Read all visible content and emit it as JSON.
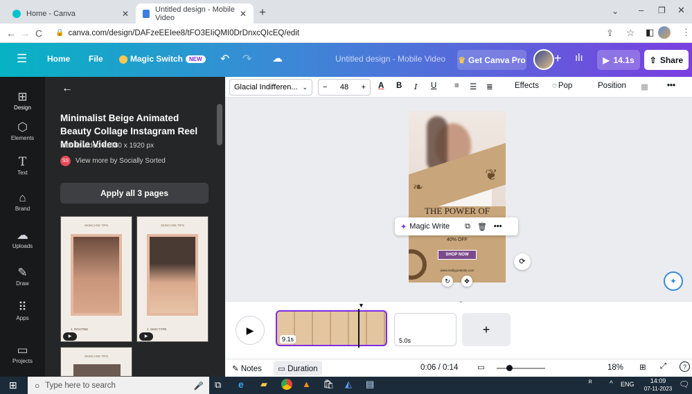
{
  "browser": {
    "tabs": [
      {
        "title": "Home - Canva"
      },
      {
        "title": "Untitled design - Mobile Video"
      }
    ],
    "url": "canva.com/design/DAFzeEEIee8/tFO3EIiQMI0DrDnxcQIcEQ/edit"
  },
  "header": {
    "home": "Home",
    "file": "File",
    "magic_switch": "Magic Switch",
    "new_badge": "NEW",
    "doc_title": "Untitled design - Mobile Video",
    "get_pro": "Get Canva Pro",
    "duration": "14.1s",
    "share": "Share"
  },
  "rail": [
    {
      "label": "Design",
      "icon": "design-icon"
    },
    {
      "label": "Elements",
      "icon": "elements-icon"
    },
    {
      "label": "Text",
      "icon": "text-icon"
    },
    {
      "label": "Brand",
      "icon": "brand-icon"
    },
    {
      "label": "Uploads",
      "icon": "uploads-icon"
    },
    {
      "label": "Draw",
      "icon": "draw-icon"
    },
    {
      "label": "Apps",
      "icon": "apps-icon"
    },
    {
      "label": "Projects",
      "icon": "projects-icon"
    }
  ],
  "panel": {
    "title": "Minimalist Beige Animated Beauty Collage Instagram Reel Mobile Video",
    "meta": "Mobile Video • 1080 x 1920 px",
    "avatar": "SS",
    "view_more": "View more by Socially Sorted",
    "apply": "Apply all 3 pages",
    "thumbs": [
      {
        "tag": "SKINCARE TIPS",
        "caption": "1. ROUTINE"
      },
      {
        "tag": "SKINCARE TIPS",
        "caption": "2. SKIN TYPE"
      },
      {
        "tag": "SKINCARE TIPS"
      }
    ]
  },
  "toolbar": {
    "font": "Glacial Indifferen...",
    "size": "48",
    "effects": "Effects",
    "pop": "Pop",
    "position": "Position"
  },
  "design": {
    "headline": "THE POWER OF",
    "discount": "40% OFF",
    "cta": "SHOP NOW",
    "website": "www.reallygreatsite.com"
  },
  "magic_bar": {
    "label": "Magic Write"
  },
  "timeline": {
    "clip1": "9.1s",
    "clip2": "5.0s"
  },
  "bottom": {
    "notes": "Notes",
    "duration": "Duration",
    "time": "0:06 / 0:14",
    "zoom": "18%"
  },
  "taskbar": {
    "search": "Type here to search",
    "lang": "ENG",
    "time": "14:09",
    "date": "07-11-2023"
  },
  "colors": {
    "canva_purple": "#7d2ae8",
    "rail_bg": "#18191b",
    "panel_bg": "#252627",
    "design_beige": "#c8a57a",
    "cta_purple": "#7b4a8c"
  }
}
